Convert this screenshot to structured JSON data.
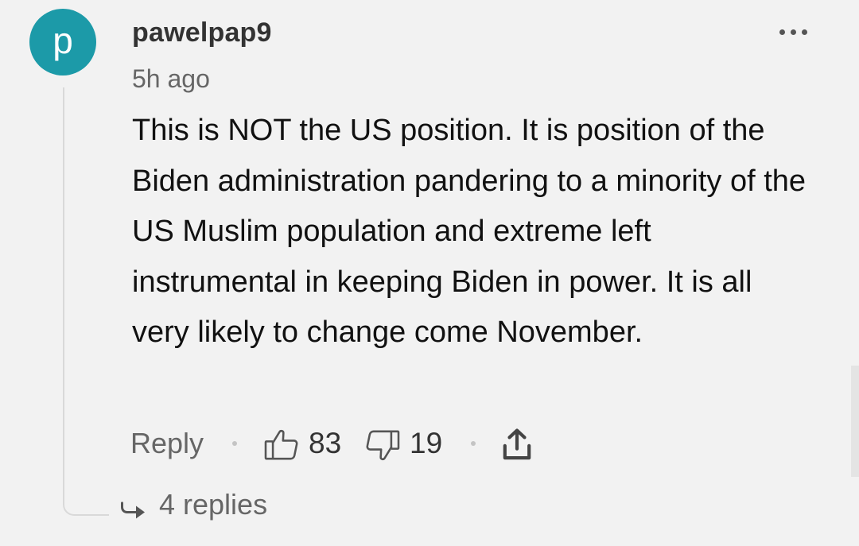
{
  "comment": {
    "avatar_letter": "p",
    "avatar_color": "#1c9aa8",
    "username": "pawelpap9",
    "timestamp": "5h ago",
    "body": "This is NOT the US position. It is position of the Biden administration pandering to a minority of the US Muslim population and extreme left instrumental in keeping Biden in power. It is all very likely to change come November.",
    "more_icon": "more-horizontal-icon"
  },
  "actions": {
    "reply_label": "Reply",
    "upvote_icon": "thumbs-up-icon",
    "upvotes": "83",
    "downvote_icon": "thumbs-down-icon",
    "downvotes": "19",
    "share_icon": "share-icon"
  },
  "replies": {
    "icon": "reply-arrow-icon",
    "label": "4 replies"
  }
}
